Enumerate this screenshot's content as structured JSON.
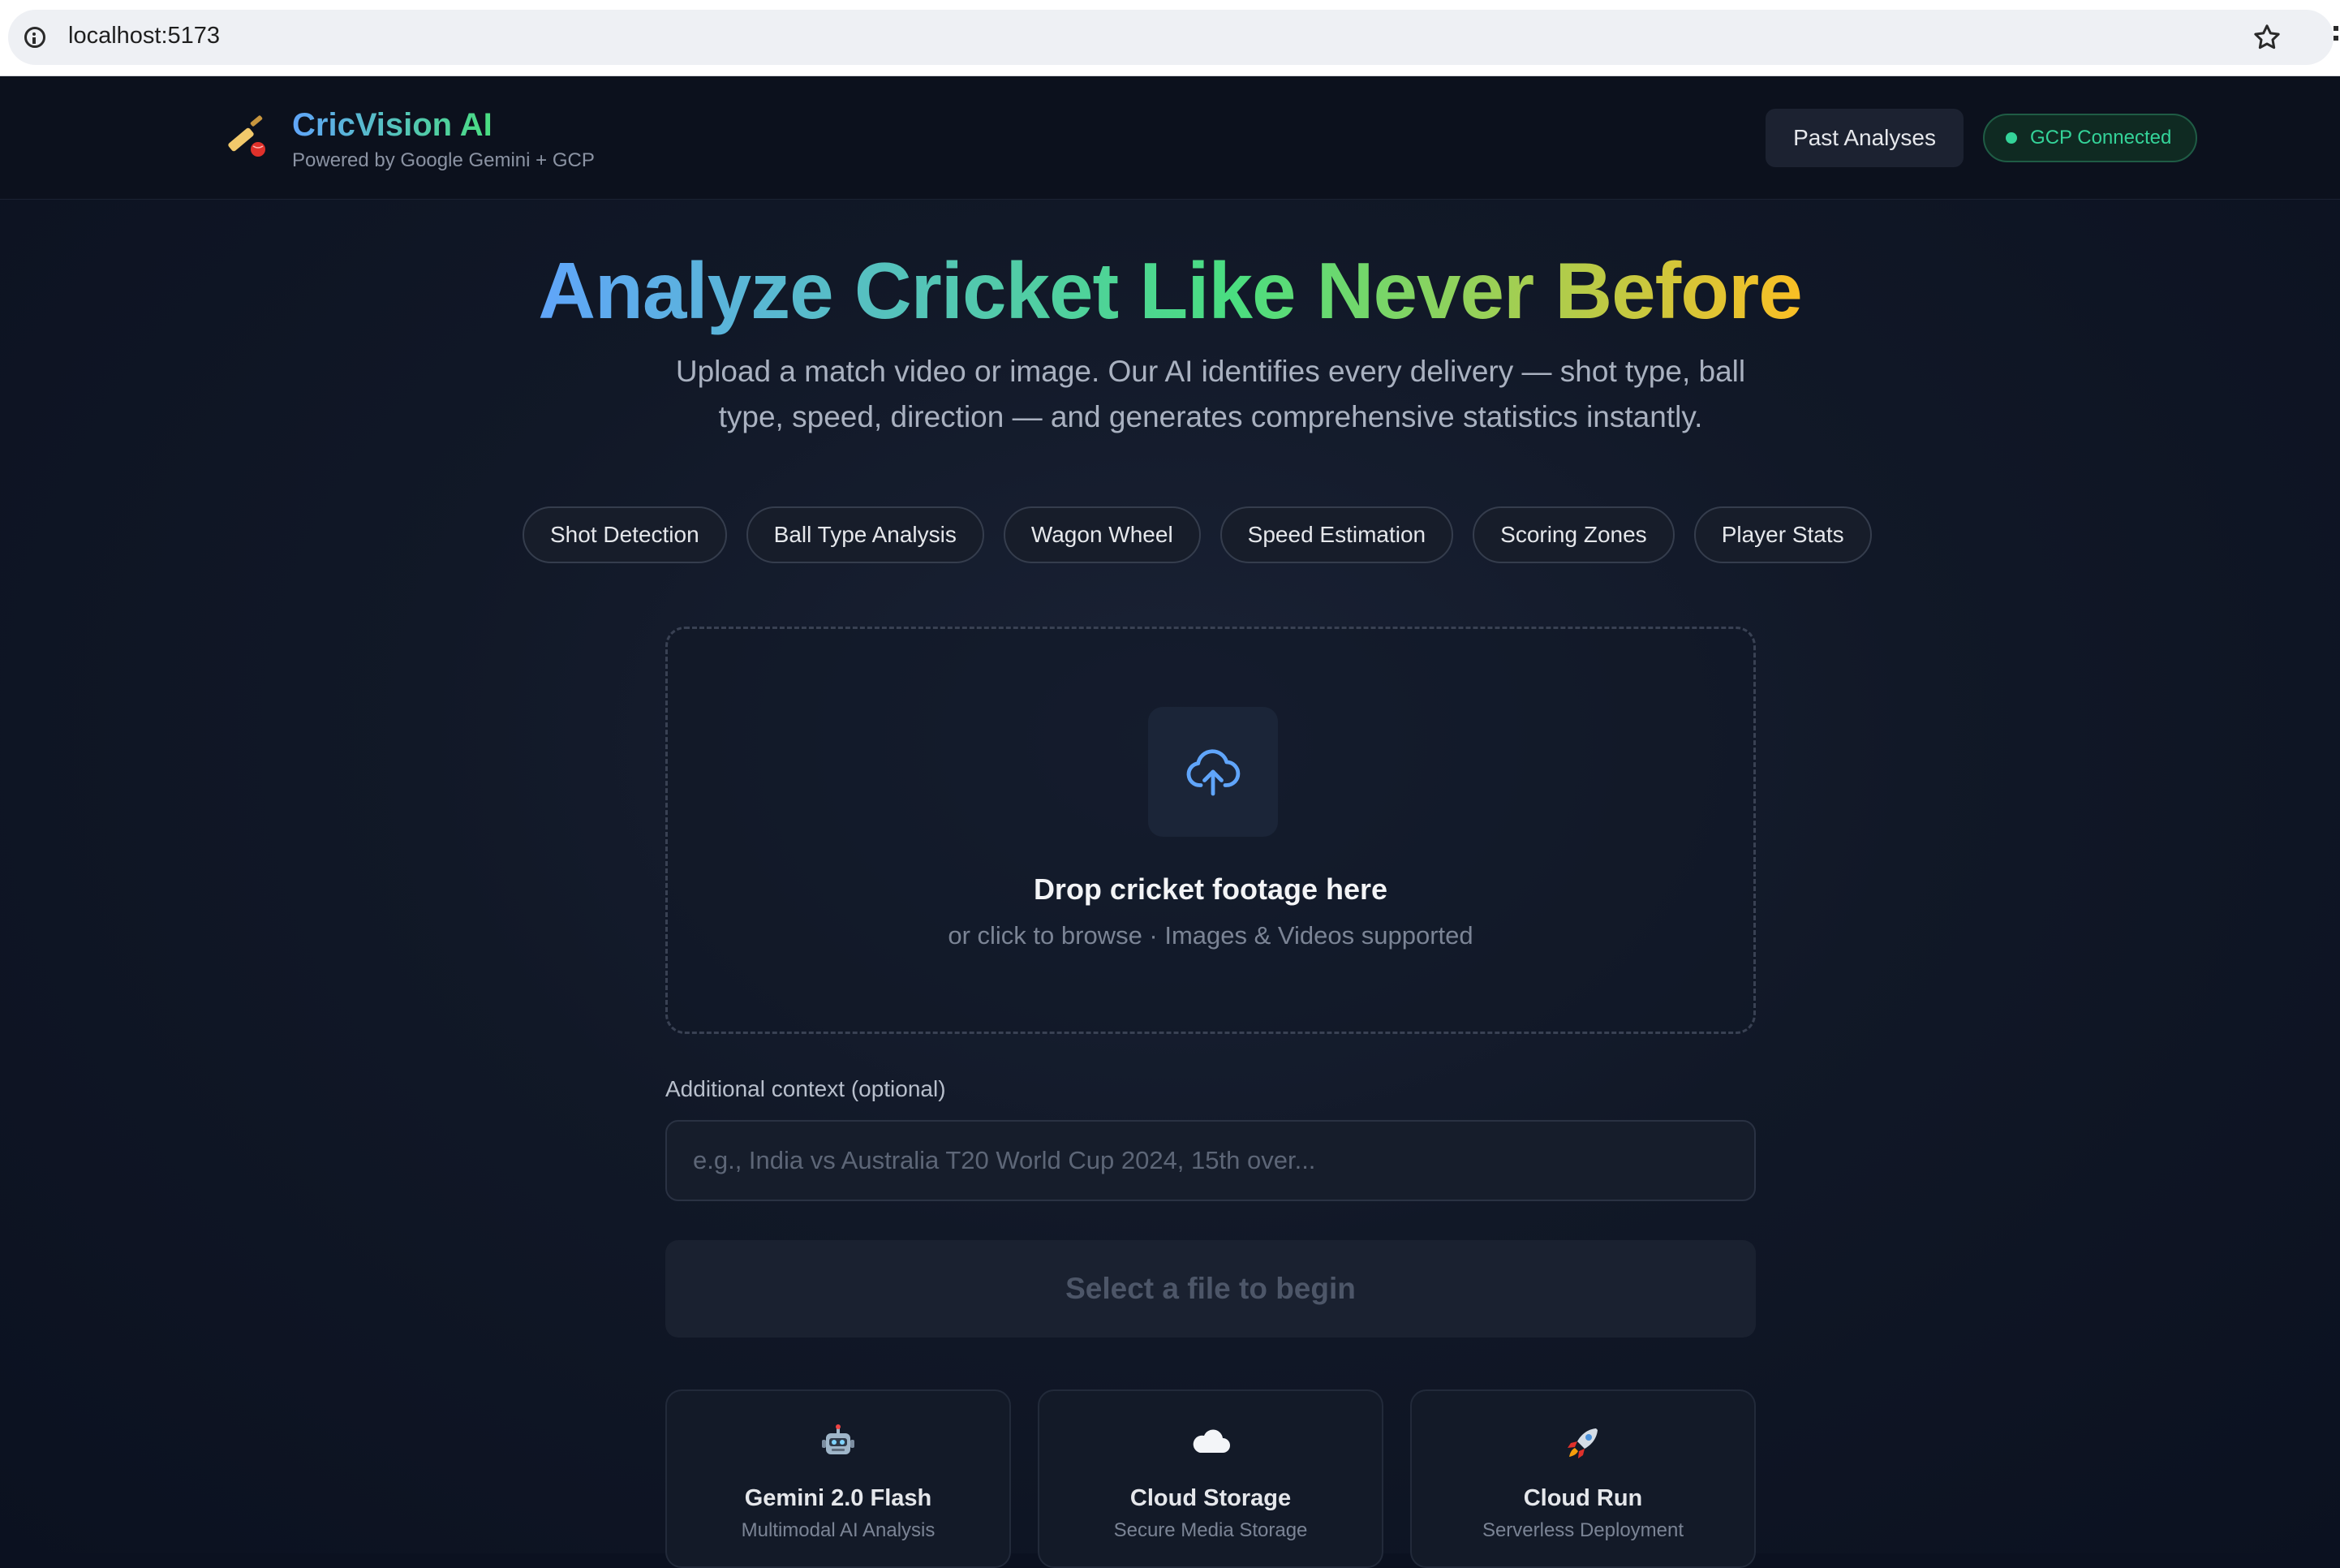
{
  "browser": {
    "url": "localhost:5173"
  },
  "header": {
    "title": "CricVision AI",
    "subtitle": "Powered by Google Gemini + GCP",
    "past_analyses_label": "Past Analyses",
    "status_label": "GCP Connected",
    "logo_icon": "cricket-bat-ball-icon"
  },
  "hero": {
    "title": "Analyze Cricket Like Never Before",
    "subtitle": "Upload a match video or image. Our AI identifies every delivery — shot type, ball type, speed, direction — and generates comprehensive statistics instantly."
  },
  "features": [
    "Shot Detection",
    "Ball Type Analysis",
    "Wagon Wheel",
    "Speed Estimation",
    "Scoring Zones",
    "Player Stats"
  ],
  "upload": {
    "title": "Drop cricket footage here",
    "subtitle": "or click to browse · Images & Videos supported",
    "icon": "cloud-upload-icon"
  },
  "context": {
    "label": "Additional context (optional)",
    "placeholder": "e.g., India vs Australia T20 World Cup 2024, 15th over...",
    "value": ""
  },
  "submit": {
    "label": "Select a file to begin"
  },
  "cards": [
    {
      "icon": "robot-icon",
      "title": "Gemini 2.0 Flash",
      "subtitle": "Multimodal AI Analysis"
    },
    {
      "icon": "cloud-icon",
      "title": "Cloud Storage",
      "subtitle": "Secure Media Storage"
    },
    {
      "icon": "rocket-icon",
      "title": "Cloud Run",
      "subtitle": "Serverless Deployment"
    }
  ],
  "colors": {
    "background": "#0b1120",
    "accent_blue": "#60a5fa",
    "accent_green": "#4ade80",
    "accent_yellow": "#fbbf24",
    "status_green": "#34d399"
  }
}
